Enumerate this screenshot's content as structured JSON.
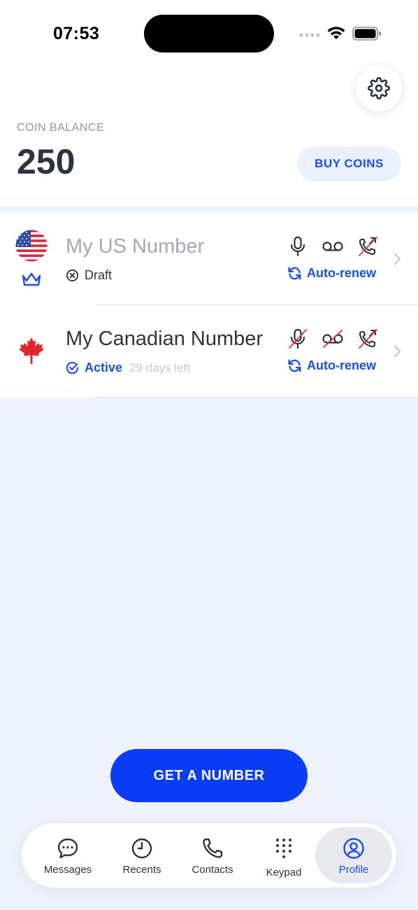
{
  "status_bar": {
    "time": "07:53"
  },
  "header": {
    "coin_label": "COIN BALANCE",
    "coin_value": "250",
    "buy_label": "BUY COINS"
  },
  "numbers": [
    {
      "title": "My US Number",
      "flag": "us-flag",
      "badge": "crown-icon",
      "status": "Draft",
      "days_left": "",
      "renew": "Auto-renew",
      "features": {
        "voice": true,
        "voicemail": true,
        "call_forwarding": false
      }
    },
    {
      "title": "My Canadian Number",
      "flag": "canada-flag",
      "status": "Active",
      "days_left": "29 days left",
      "renew": "Auto-renew",
      "features": {
        "voice": false,
        "voicemail": false,
        "call_forwarding": false
      }
    }
  ],
  "cta": {
    "label": "GET A NUMBER"
  },
  "tabs": [
    {
      "label": "Messages",
      "icon": "chat-bubble-icon"
    },
    {
      "label": "Recents",
      "icon": "clock-icon"
    },
    {
      "label": "Contacts",
      "icon": "phone-icon"
    },
    {
      "label": "Keypad",
      "icon": "keypad-icon"
    },
    {
      "label": "Profile",
      "icon": "profile-icon",
      "selected": true
    }
  ],
  "colors": {
    "accent": "#0a3df5",
    "link": "#1a4ee6",
    "background": "#eef2fb",
    "strike": "#e5322d"
  }
}
